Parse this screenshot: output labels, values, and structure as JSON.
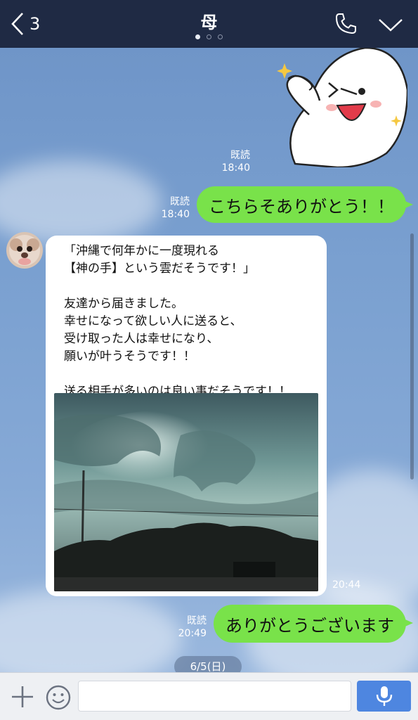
{
  "header": {
    "back_count": "3",
    "title": "母",
    "page_dots": 3,
    "active_dot": 0
  },
  "messages": {
    "sticker": {
      "icon": "smiling-face-sticker-icon"
    },
    "sticker_meta": {
      "read": "既読",
      "time": "18:40"
    },
    "out1": {
      "read": "既読",
      "time": "18:40",
      "text": "こちらそありがとう！！"
    },
    "in1": {
      "avatar_icon": "dog-avatar-icon",
      "text": "「沖縄で何年かに一度現れる\n【神の手】という雲だそうです！」\n\n友達から届きました。\n幸せになって欲しい人に送ると、\n受け取った人は幸せになり、\n願いが叶うそうです！！\n\n送る相手が多いのは良い事だそうです！！",
      "photo_icon": "hand-shaped-cloud-photo",
      "time": "20:44"
    },
    "out2": {
      "read": "既読",
      "time": "20:49",
      "text": "ありがとうございます"
    },
    "date_separator": "6/5(日)"
  },
  "input_bar": {
    "placeholder": "",
    "plus_icon": "plus-icon",
    "emoji_icon": "emoji-icon",
    "mic_icon": "microphone-icon"
  },
  "colors": {
    "header_bg": "#1f2a44",
    "bubble_out": "#79e24a",
    "bubble_in": "#ffffff",
    "mic_button": "#4e86e0"
  }
}
